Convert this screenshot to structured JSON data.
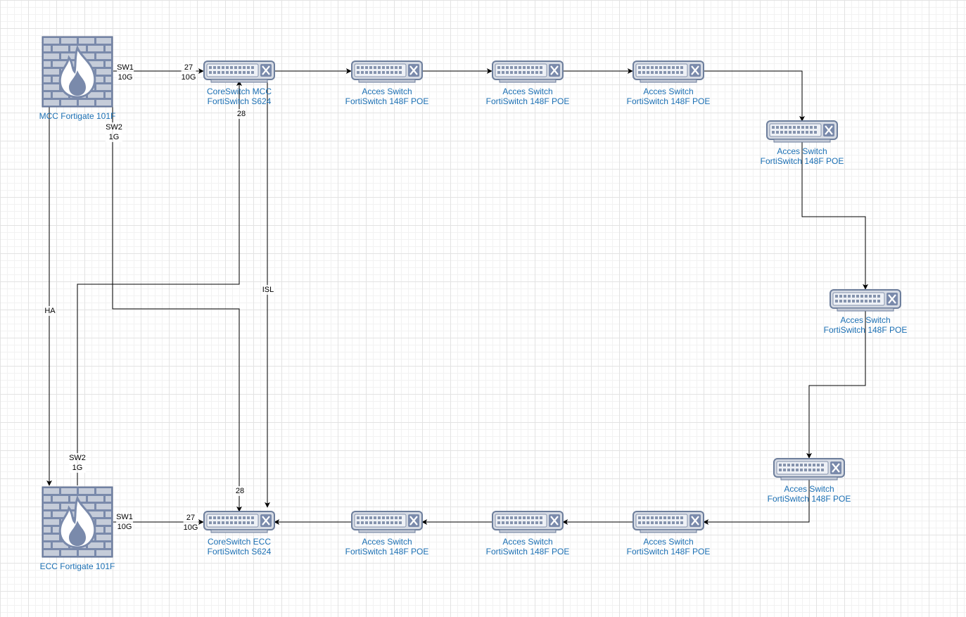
{
  "colors": {
    "edge": "#000000",
    "node_label": "#1b6fb3",
    "device_fill": "#d6dbe4",
    "device_stroke": "#6d7e9c",
    "firewall_fill": "#7a8aab"
  },
  "nodes": {
    "mcc_fw": {
      "icon": "firewall-icon",
      "lines": [
        "MCC Fortigate 101F"
      ]
    },
    "ecc_fw": {
      "icon": "firewall-icon",
      "lines": [
        "ECC Fortigate 101F"
      ]
    },
    "core_mcc": {
      "icon": "switch-icon",
      "lines": [
        "CoreSwitch MCC",
        "FortiSwitch S624"
      ]
    },
    "core_ecc": {
      "icon": "switch-icon",
      "lines": [
        "CoreSwitch ECC",
        "FortiSwitch S624"
      ]
    },
    "as1": {
      "icon": "switch-icon",
      "lines": [
        "Acces Switch",
        "FortiSwitch 148F POE"
      ]
    },
    "as2": {
      "icon": "switch-icon",
      "lines": [
        "Acces Switch",
        "FortiSwitch 148F POE"
      ]
    },
    "as3": {
      "icon": "switch-icon",
      "lines": [
        "Acces Switch",
        "FortiSwitch 148F POE"
      ]
    },
    "as4": {
      "icon": "switch-icon",
      "lines": [
        "Acces Switch",
        "FortiSwitch 148F POE"
      ]
    },
    "as5": {
      "icon": "switch-icon",
      "lines": [
        "Acces Switch",
        "FortiSwitch 148F POE"
      ]
    },
    "as6": {
      "icon": "switch-icon",
      "lines": [
        "Acces Switch",
        "FortiSwitch 148F POE"
      ]
    },
    "as7": {
      "icon": "switch-icon",
      "lines": [
        "Acces Switch",
        "FortiSwitch 148F POE"
      ]
    },
    "as8": {
      "icon": "switch-icon",
      "lines": [
        "Acces Switch",
        "FortiSwitch 148F POE"
      ]
    },
    "as9": {
      "icon": "switch-icon",
      "lines": [
        "Acces Switch",
        "FortiSwitch 148F POE"
      ]
    }
  },
  "edge_labels": {
    "mcc_sw1": [
      "SW1",
      "10G"
    ],
    "mcc_port27": [
      "27",
      "10G"
    ],
    "mcc_sw2": [
      "SW2",
      "1G"
    ],
    "mcc_port28": [
      "28"
    ],
    "isl": [
      "ISL"
    ],
    "ha": [
      "HA"
    ],
    "ecc_sw2": [
      "SW2",
      "1G"
    ],
    "ecc_port28": [
      "28"
    ],
    "ecc_sw1": [
      "SW1",
      "10G"
    ],
    "ecc_port27": [
      "27",
      "10G"
    ]
  },
  "edges": [
    {
      "id": "mcc-fw-to-core-mcc",
      "from": "mcc_fw",
      "to": "core_mcc"
    },
    {
      "id": "core-mcc-to-as1",
      "from": "core_mcc",
      "to": "as1"
    },
    {
      "id": "as1-to-as2",
      "from": "as1",
      "to": "as2"
    },
    {
      "id": "as2-to-as3",
      "from": "as2",
      "to": "as3"
    },
    {
      "id": "as3-to-as4",
      "from": "as3",
      "to": "as4"
    },
    {
      "id": "as4-to-as5",
      "from": "as4",
      "to": "as5"
    },
    {
      "id": "as5-to-as6",
      "from": "as5",
      "to": "as6"
    },
    {
      "id": "as6-to-as7",
      "from": "as6",
      "to": "as7"
    },
    {
      "id": "as7-to-as8",
      "from": "as7",
      "to": "as8"
    },
    {
      "id": "as8-to-as9",
      "from": "as8",
      "to": "as9"
    },
    {
      "id": "as9-to-core-ecc",
      "from": "as9",
      "to": "core_ecc"
    },
    {
      "id": "ecc-fw-to-core-ecc",
      "from": "ecc_fw",
      "to": "core_ecc"
    },
    {
      "id": "mcc-fw-ha-ecc-fw",
      "from": "mcc_fw",
      "to": "ecc_fw"
    },
    {
      "id": "mcc-fw-sw2-to-core-ecc",
      "from": "mcc_fw",
      "to": "core_ecc"
    },
    {
      "id": "ecc-fw-sw2-to-core-mcc",
      "from": "ecc_fw",
      "to": "core_mcc"
    },
    {
      "id": "core-mcc-isl-core-ecc",
      "from": "core_mcc",
      "to": "core_ecc"
    }
  ]
}
